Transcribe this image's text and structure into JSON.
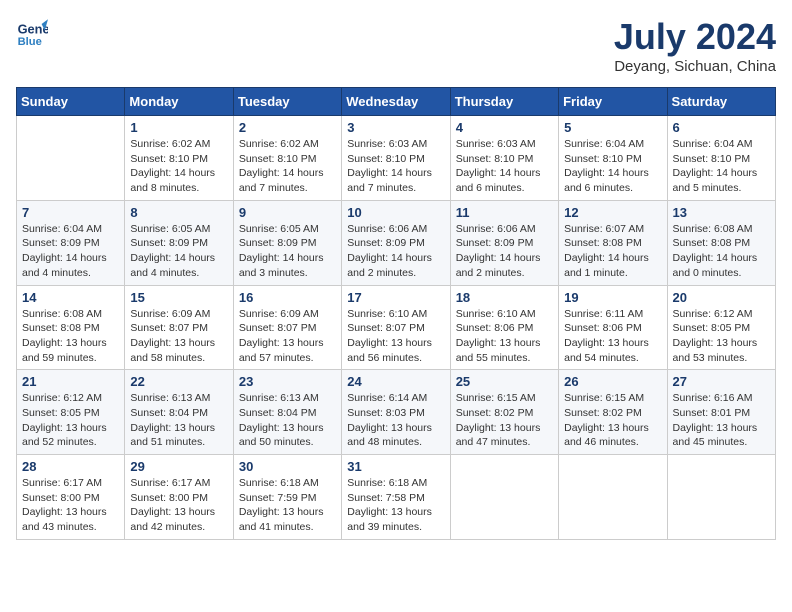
{
  "header": {
    "logo_line1": "General",
    "logo_line2": "Blue",
    "month": "July 2024",
    "location": "Deyang, Sichuan, China"
  },
  "weekdays": [
    "Sunday",
    "Monday",
    "Tuesday",
    "Wednesday",
    "Thursday",
    "Friday",
    "Saturday"
  ],
  "weeks": [
    [
      {
        "day": "",
        "sunrise": "",
        "sunset": "",
        "daylight": ""
      },
      {
        "day": "1",
        "sunrise": "Sunrise: 6:02 AM",
        "sunset": "Sunset: 8:10 PM",
        "daylight": "Daylight: 14 hours and 8 minutes."
      },
      {
        "day": "2",
        "sunrise": "Sunrise: 6:02 AM",
        "sunset": "Sunset: 8:10 PM",
        "daylight": "Daylight: 14 hours and 7 minutes."
      },
      {
        "day": "3",
        "sunrise": "Sunrise: 6:03 AM",
        "sunset": "Sunset: 8:10 PM",
        "daylight": "Daylight: 14 hours and 7 minutes."
      },
      {
        "day": "4",
        "sunrise": "Sunrise: 6:03 AM",
        "sunset": "Sunset: 8:10 PM",
        "daylight": "Daylight: 14 hours and 6 minutes."
      },
      {
        "day": "5",
        "sunrise": "Sunrise: 6:04 AM",
        "sunset": "Sunset: 8:10 PM",
        "daylight": "Daylight: 14 hours and 6 minutes."
      },
      {
        "day": "6",
        "sunrise": "Sunrise: 6:04 AM",
        "sunset": "Sunset: 8:10 PM",
        "daylight": "Daylight: 14 hours and 5 minutes."
      }
    ],
    [
      {
        "day": "7",
        "sunrise": "Sunrise: 6:04 AM",
        "sunset": "Sunset: 8:09 PM",
        "daylight": "Daylight: 14 hours and 4 minutes."
      },
      {
        "day": "8",
        "sunrise": "Sunrise: 6:05 AM",
        "sunset": "Sunset: 8:09 PM",
        "daylight": "Daylight: 14 hours and 4 minutes."
      },
      {
        "day": "9",
        "sunrise": "Sunrise: 6:05 AM",
        "sunset": "Sunset: 8:09 PM",
        "daylight": "Daylight: 14 hours and 3 minutes."
      },
      {
        "day": "10",
        "sunrise": "Sunrise: 6:06 AM",
        "sunset": "Sunset: 8:09 PM",
        "daylight": "Daylight: 14 hours and 2 minutes."
      },
      {
        "day": "11",
        "sunrise": "Sunrise: 6:06 AM",
        "sunset": "Sunset: 8:09 PM",
        "daylight": "Daylight: 14 hours and 2 minutes."
      },
      {
        "day": "12",
        "sunrise": "Sunrise: 6:07 AM",
        "sunset": "Sunset: 8:08 PM",
        "daylight": "Daylight: 14 hours and 1 minute."
      },
      {
        "day": "13",
        "sunrise": "Sunrise: 6:08 AM",
        "sunset": "Sunset: 8:08 PM",
        "daylight": "Daylight: 14 hours and 0 minutes."
      }
    ],
    [
      {
        "day": "14",
        "sunrise": "Sunrise: 6:08 AM",
        "sunset": "Sunset: 8:08 PM",
        "daylight": "Daylight: 13 hours and 59 minutes."
      },
      {
        "day": "15",
        "sunrise": "Sunrise: 6:09 AM",
        "sunset": "Sunset: 8:07 PM",
        "daylight": "Daylight: 13 hours and 58 minutes."
      },
      {
        "day": "16",
        "sunrise": "Sunrise: 6:09 AM",
        "sunset": "Sunset: 8:07 PM",
        "daylight": "Daylight: 13 hours and 57 minutes."
      },
      {
        "day": "17",
        "sunrise": "Sunrise: 6:10 AM",
        "sunset": "Sunset: 8:07 PM",
        "daylight": "Daylight: 13 hours and 56 minutes."
      },
      {
        "day": "18",
        "sunrise": "Sunrise: 6:10 AM",
        "sunset": "Sunset: 8:06 PM",
        "daylight": "Daylight: 13 hours and 55 minutes."
      },
      {
        "day": "19",
        "sunrise": "Sunrise: 6:11 AM",
        "sunset": "Sunset: 8:06 PM",
        "daylight": "Daylight: 13 hours and 54 minutes."
      },
      {
        "day": "20",
        "sunrise": "Sunrise: 6:12 AM",
        "sunset": "Sunset: 8:05 PM",
        "daylight": "Daylight: 13 hours and 53 minutes."
      }
    ],
    [
      {
        "day": "21",
        "sunrise": "Sunrise: 6:12 AM",
        "sunset": "Sunset: 8:05 PM",
        "daylight": "Daylight: 13 hours and 52 minutes."
      },
      {
        "day": "22",
        "sunrise": "Sunrise: 6:13 AM",
        "sunset": "Sunset: 8:04 PM",
        "daylight": "Daylight: 13 hours and 51 minutes."
      },
      {
        "day": "23",
        "sunrise": "Sunrise: 6:13 AM",
        "sunset": "Sunset: 8:04 PM",
        "daylight": "Daylight: 13 hours and 50 minutes."
      },
      {
        "day": "24",
        "sunrise": "Sunrise: 6:14 AM",
        "sunset": "Sunset: 8:03 PM",
        "daylight": "Daylight: 13 hours and 48 minutes."
      },
      {
        "day": "25",
        "sunrise": "Sunrise: 6:15 AM",
        "sunset": "Sunset: 8:02 PM",
        "daylight": "Daylight: 13 hours and 47 minutes."
      },
      {
        "day": "26",
        "sunrise": "Sunrise: 6:15 AM",
        "sunset": "Sunset: 8:02 PM",
        "daylight": "Daylight: 13 hours and 46 minutes."
      },
      {
        "day": "27",
        "sunrise": "Sunrise: 6:16 AM",
        "sunset": "Sunset: 8:01 PM",
        "daylight": "Daylight: 13 hours and 45 minutes."
      }
    ],
    [
      {
        "day": "28",
        "sunrise": "Sunrise: 6:17 AM",
        "sunset": "Sunset: 8:00 PM",
        "daylight": "Daylight: 13 hours and 43 minutes."
      },
      {
        "day": "29",
        "sunrise": "Sunrise: 6:17 AM",
        "sunset": "Sunset: 8:00 PM",
        "daylight": "Daylight: 13 hours and 42 minutes."
      },
      {
        "day": "30",
        "sunrise": "Sunrise: 6:18 AM",
        "sunset": "Sunset: 7:59 PM",
        "daylight": "Daylight: 13 hours and 41 minutes."
      },
      {
        "day": "31",
        "sunrise": "Sunrise: 6:18 AM",
        "sunset": "Sunset: 7:58 PM",
        "daylight": "Daylight: 13 hours and 39 minutes."
      },
      {
        "day": "",
        "sunrise": "",
        "sunset": "",
        "daylight": ""
      },
      {
        "day": "",
        "sunrise": "",
        "sunset": "",
        "daylight": ""
      },
      {
        "day": "",
        "sunrise": "",
        "sunset": "",
        "daylight": ""
      }
    ]
  ]
}
